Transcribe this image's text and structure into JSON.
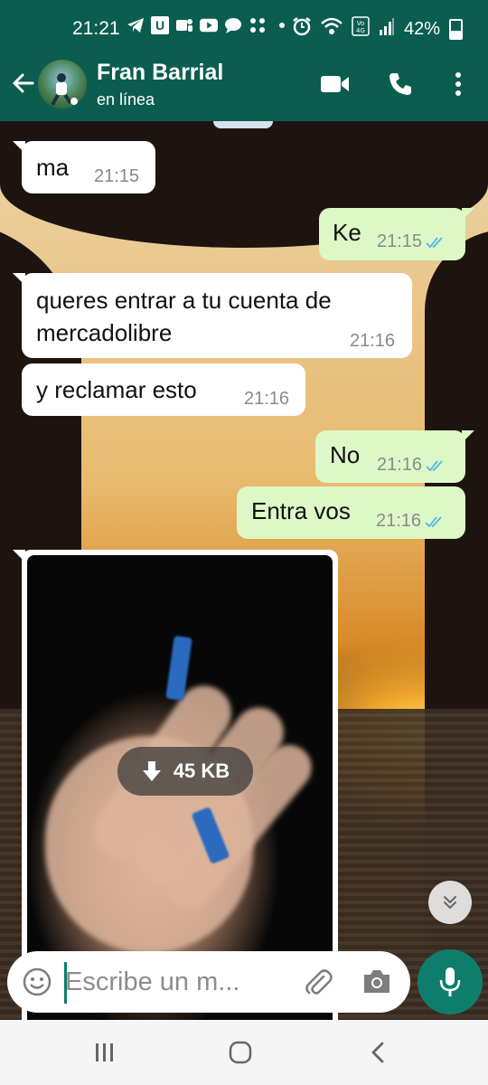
{
  "status_bar": {
    "time": "21:21",
    "app_icons": [
      "telegram-icon",
      "u-icon",
      "teams-icon",
      "youtube-icon",
      "chat-icon",
      "apps-icon"
    ],
    "system_icons": [
      "alarm-icon",
      "wifi-icon",
      "volte-icon",
      "signal-icon"
    ],
    "battery_percent": "42%",
    "battery_level": 0.42
  },
  "header": {
    "contact_name": "Fran Barrial",
    "contact_status": "en línea",
    "accent_color": "#0b5d50"
  },
  "messages": [
    {
      "direction": "in",
      "text": "ma",
      "time": "21:15"
    },
    {
      "direction": "out",
      "text": "Ke",
      "time": "21:15",
      "read": true
    },
    {
      "direction": "in",
      "text_lines": [
        "queres entrar a tu cuenta de",
        "mercadolibre"
      ],
      "time": "21:16"
    },
    {
      "direction": "in",
      "text": "y reclamar esto",
      "time": "21:16"
    },
    {
      "direction": "out",
      "text": "No",
      "time": "21:16",
      "read": true
    },
    {
      "direction": "out",
      "text": "Entra vos",
      "time": "21:16",
      "read": true
    },
    {
      "direction": "in",
      "type": "image",
      "download_size": "45 KB"
    }
  ],
  "composer": {
    "placeholder": "Escribe un m...",
    "value": ""
  },
  "colors": {
    "outgoing_bubble": "#dcf8c6",
    "incoming_bubble": "#ffffff",
    "read_tick": "#4fb6ec",
    "mic_button": "#0f7d6c"
  }
}
